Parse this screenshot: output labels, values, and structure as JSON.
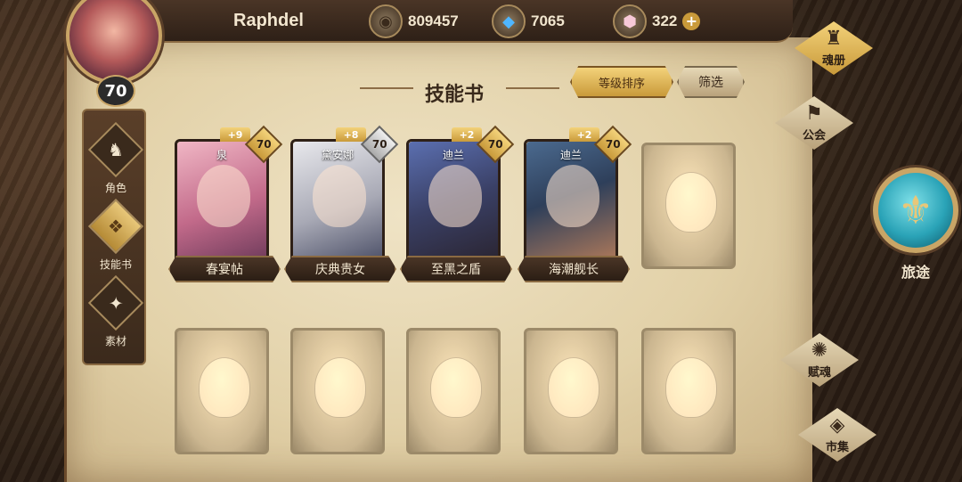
{
  "player": {
    "name": "Raphdel",
    "level": "70"
  },
  "currencies": [
    {
      "icon": "gold-coin-icon",
      "value": "809457"
    },
    {
      "icon": "blue-crystal-icon",
      "value": "7065"
    },
    {
      "icon": "pink-gem-icon",
      "value": "322"
    }
  ],
  "left_nav": [
    {
      "label": "角色",
      "active": false
    },
    {
      "label": "技能书",
      "active": true
    },
    {
      "label": "素材",
      "active": false
    }
  ],
  "page": {
    "title": "技能书",
    "sort_label": "等级排序",
    "filter_label": "筛选"
  },
  "cards": [
    {
      "hero": "泉",
      "book": "春宴帖",
      "plus": "+9",
      "level": "70"
    },
    {
      "hero": "黛安娜",
      "book": "庆典贵女",
      "plus": "+8",
      "level": "70"
    },
    {
      "hero": "迪兰",
      "book": "至黑之盾",
      "plus": "+2",
      "level": "70"
    },
    {
      "hero": "迪兰",
      "book": "海潮舰长",
      "plus": "+2",
      "level": "70"
    }
  ],
  "right_nav": [
    {
      "label": "魂册"
    },
    {
      "label": "公会"
    },
    {
      "label": "旅途"
    },
    {
      "label": "赋魂"
    },
    {
      "label": "市集"
    }
  ]
}
